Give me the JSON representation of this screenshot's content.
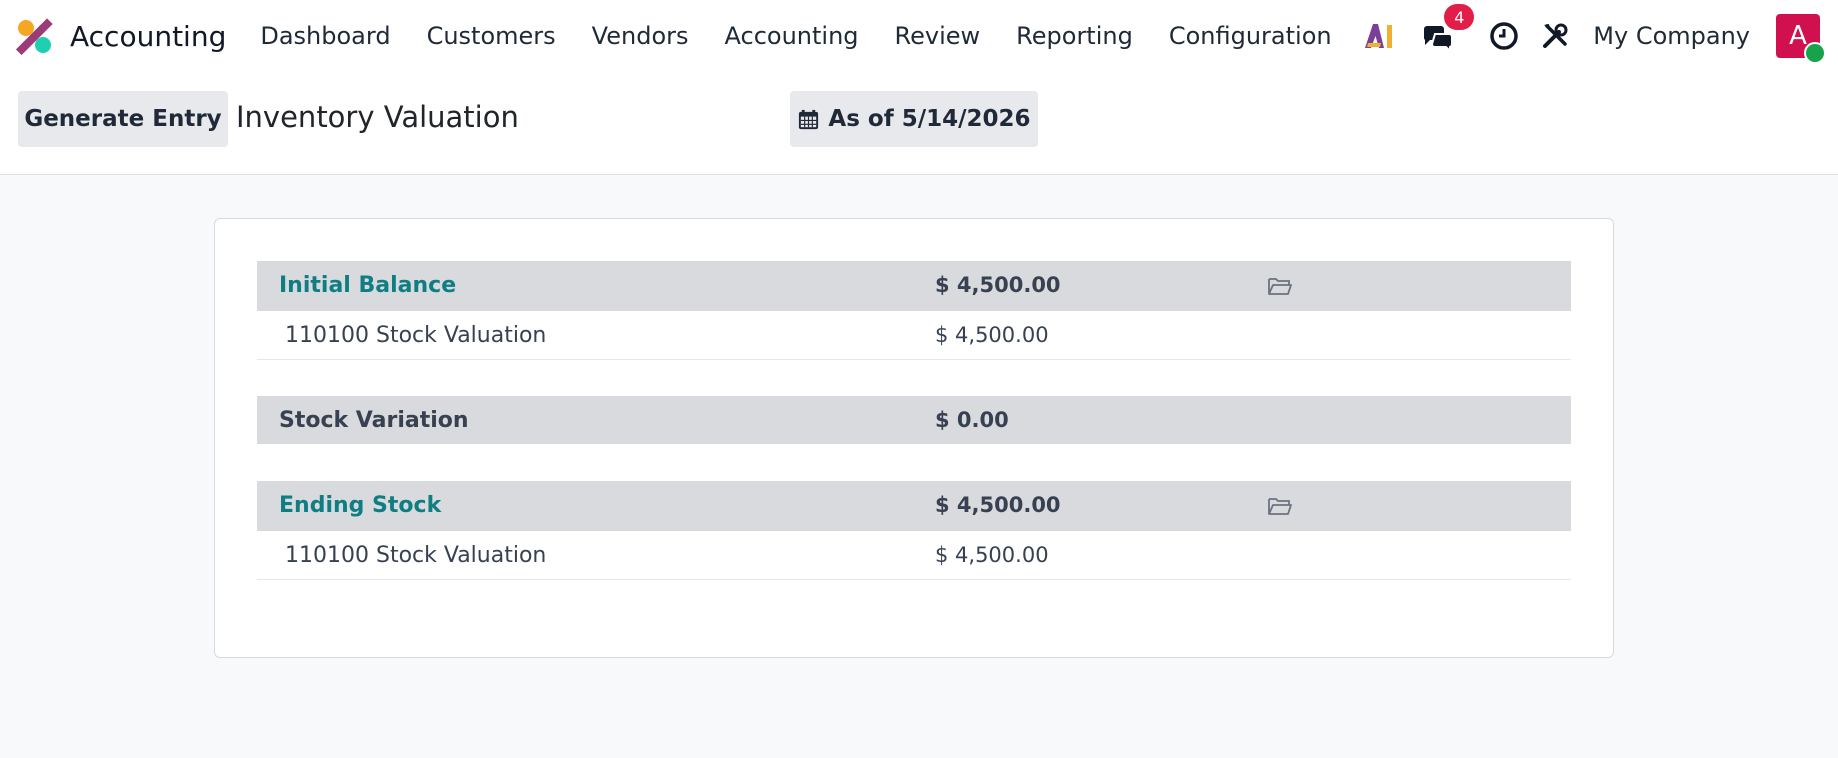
{
  "app": {
    "title": "Accounting",
    "menu": [
      "Dashboard",
      "Customers",
      "Vendors",
      "Accounting",
      "Review",
      "Reporting",
      "Configuration"
    ],
    "notifications_count": "4",
    "company": "My Company",
    "avatar_letter": "A"
  },
  "control": {
    "generate_button": "Generate Entry",
    "page_title": "Inventory Valuation",
    "date_filter": "As of 5/14/2026"
  },
  "report": {
    "initial_balance": {
      "label": "Initial Balance",
      "amount": "$ 4,500.00",
      "line": {
        "account": "110100 Stock Valuation",
        "amount": "$ 4,500.00"
      }
    },
    "stock_variation": {
      "label": "Stock Variation",
      "amount": "$ 0.00"
    },
    "ending_stock": {
      "label": "Ending Stock",
      "amount": "$ 4,500.00",
      "line": {
        "account": "110100 Stock Valuation",
        "amount": "$ 4,500.00"
      }
    }
  },
  "colors": {
    "brand_link": "#0f7e83",
    "badge": "#e11d48",
    "avatar": "#d1114f",
    "online": "#16a34a",
    "section_bg": "#d9dadd"
  },
  "icons": [
    "app-logo-icon",
    "ai-icon",
    "chat-icon",
    "clock-icon",
    "tools-icon",
    "calendar-icon",
    "folder-icon"
  ]
}
